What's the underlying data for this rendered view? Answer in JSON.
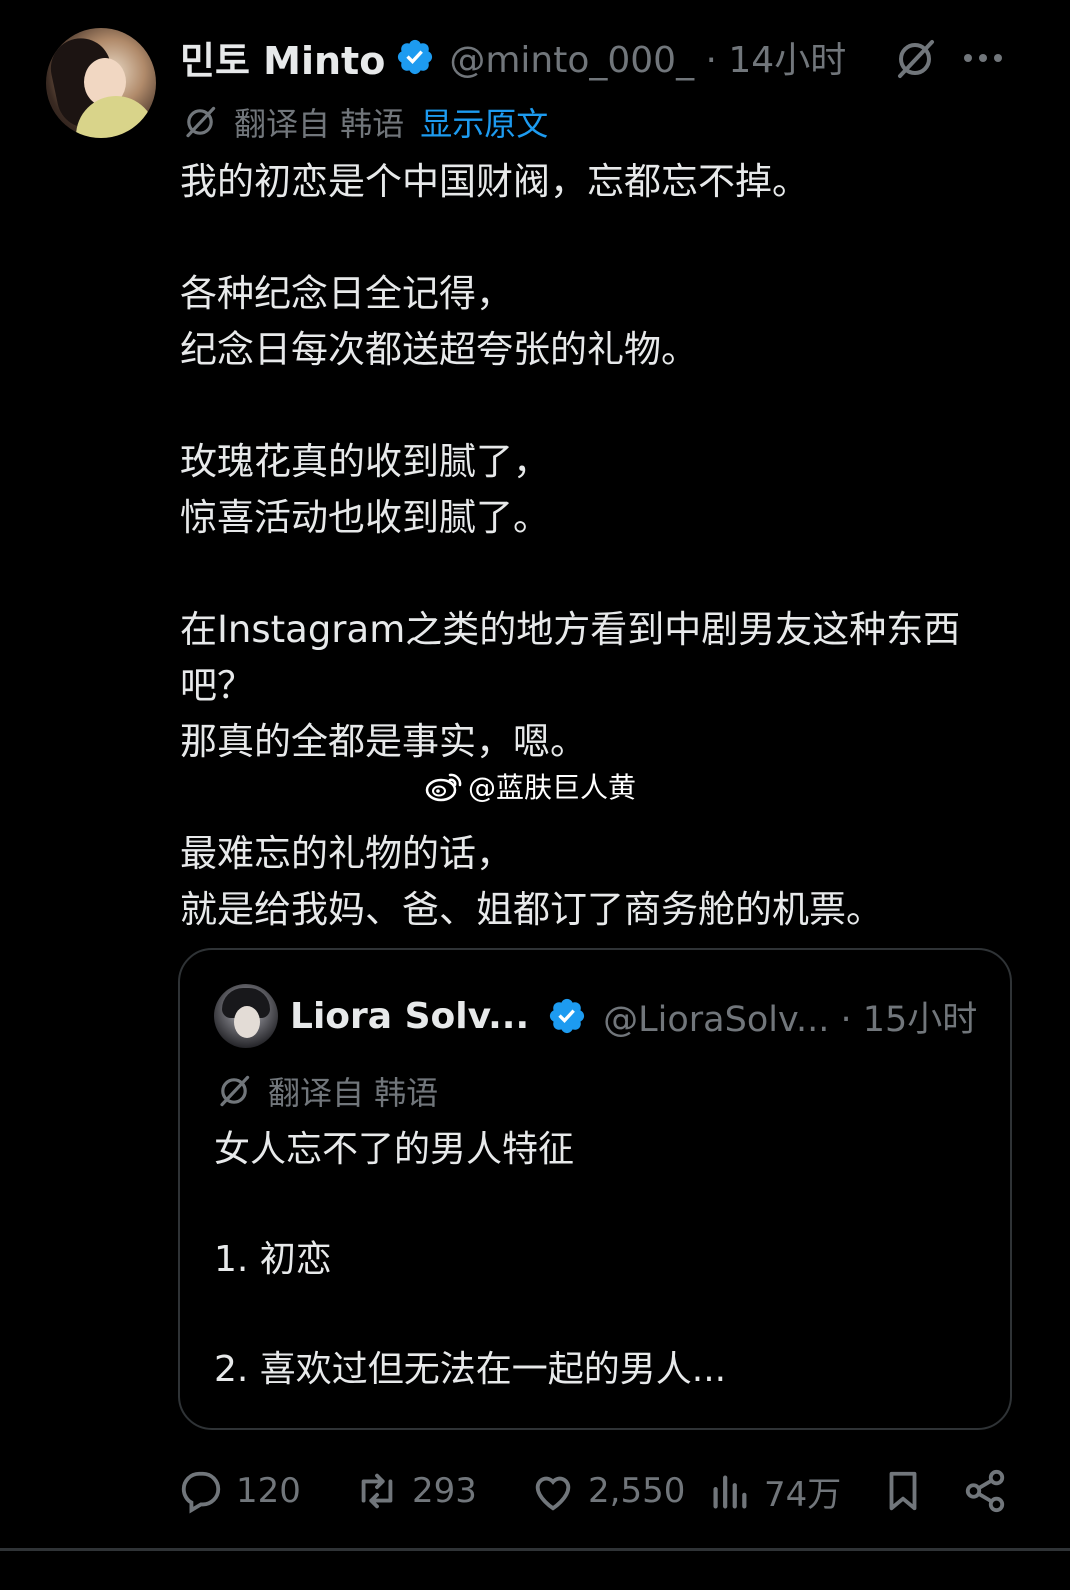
{
  "tweet": {
    "display_name": "민토 Minto",
    "handle_time": "@minto_000_ · 14小时",
    "translated_from": "翻译自 韩语",
    "show_original": "显示原文",
    "paragraphs": [
      [
        "我的初恋是个中国财阀，忘都忘不掉。"
      ],
      [
        "各种纪念日全记得，",
        "纪念日每次都送超夸张的礼物。"
      ],
      [
        "玫瑰花真的收到腻了，",
        "惊喜活动也收到腻了。"
      ],
      [
        "在Instagram之类的地方看到中剧男友这种东西吧？",
        "那真的全都是事实，嗯。"
      ],
      [
        "最难忘的礼物的话，",
        "就是给我妈、爸、姐都订了商务舱的机票。"
      ]
    ]
  },
  "watermark": "@蓝肤巨人黄",
  "quoted": {
    "display_name": "Liora Solv...",
    "handle_time": "@LioraSolv... · 15小时",
    "translated_from": "翻译自 韩语",
    "paragraphs": [
      "女人忘不了的男人特征",
      "1. 初恋",
      "2. 喜欢过但无法在一起的男人..."
    ]
  },
  "actions": {
    "replies": "120",
    "reposts": "293",
    "likes": "2,550",
    "views": "74万"
  },
  "colors": {
    "background": "#000000",
    "text": "#e7e9ea",
    "muted": "#71767b",
    "accent": "#1d9bf0",
    "border": "#2f3336"
  },
  "icons": {
    "verified": "verified-badge-icon",
    "grok": "grok-icon",
    "more": "more-options-icon",
    "translate": "translate-icon",
    "reply": "reply-icon",
    "repost": "repost-icon",
    "like": "like-icon",
    "views": "views-icon",
    "bookmark": "bookmark-icon",
    "share": "share-icon",
    "weibo": "weibo-logo-icon"
  }
}
